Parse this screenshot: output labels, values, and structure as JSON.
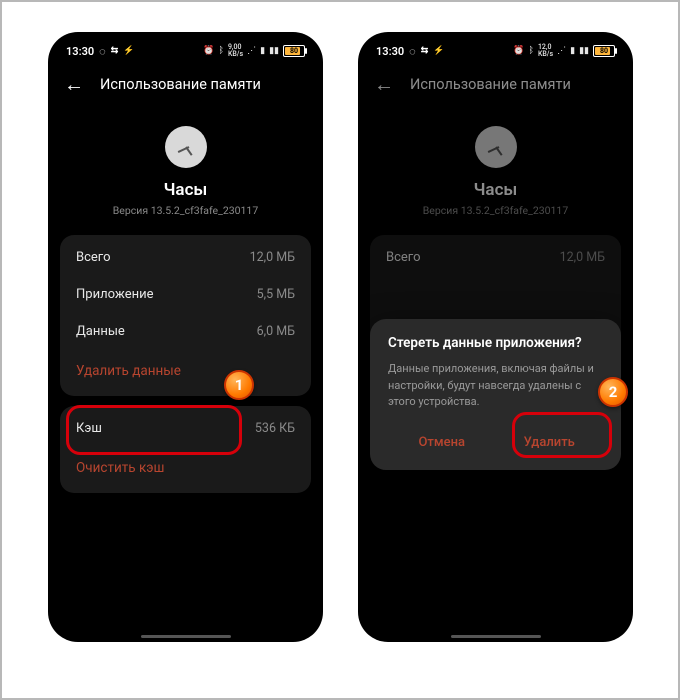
{
  "status": {
    "time": "13:30",
    "net_speed": "9,00\nKB/s",
    "net_speed2": "12,0\nKB/s",
    "battery": "80"
  },
  "header": {
    "title": "Использование памяти"
  },
  "app": {
    "name": "Часы",
    "version": "Версия 13.5.2_cf3fafe_230117"
  },
  "storage": {
    "total_label": "Всего",
    "total_value": "12,0 МБ",
    "app_label": "Приложение",
    "app_value": "5,5 МБ",
    "data_label": "Данные",
    "data_value": "6,0 МБ",
    "delete_data": "Удалить данные"
  },
  "cache": {
    "label": "Кэш",
    "value": "536 КБ",
    "clear": "Очистить кэш"
  },
  "dialog": {
    "title": "Стереть данные приложения?",
    "body": "Данные приложения, включая файлы и настройки, будут навсегда удалены с этого устройства.",
    "cancel": "Отмена",
    "confirm": "Удалить"
  },
  "markers": {
    "one": "1",
    "two": "2"
  }
}
